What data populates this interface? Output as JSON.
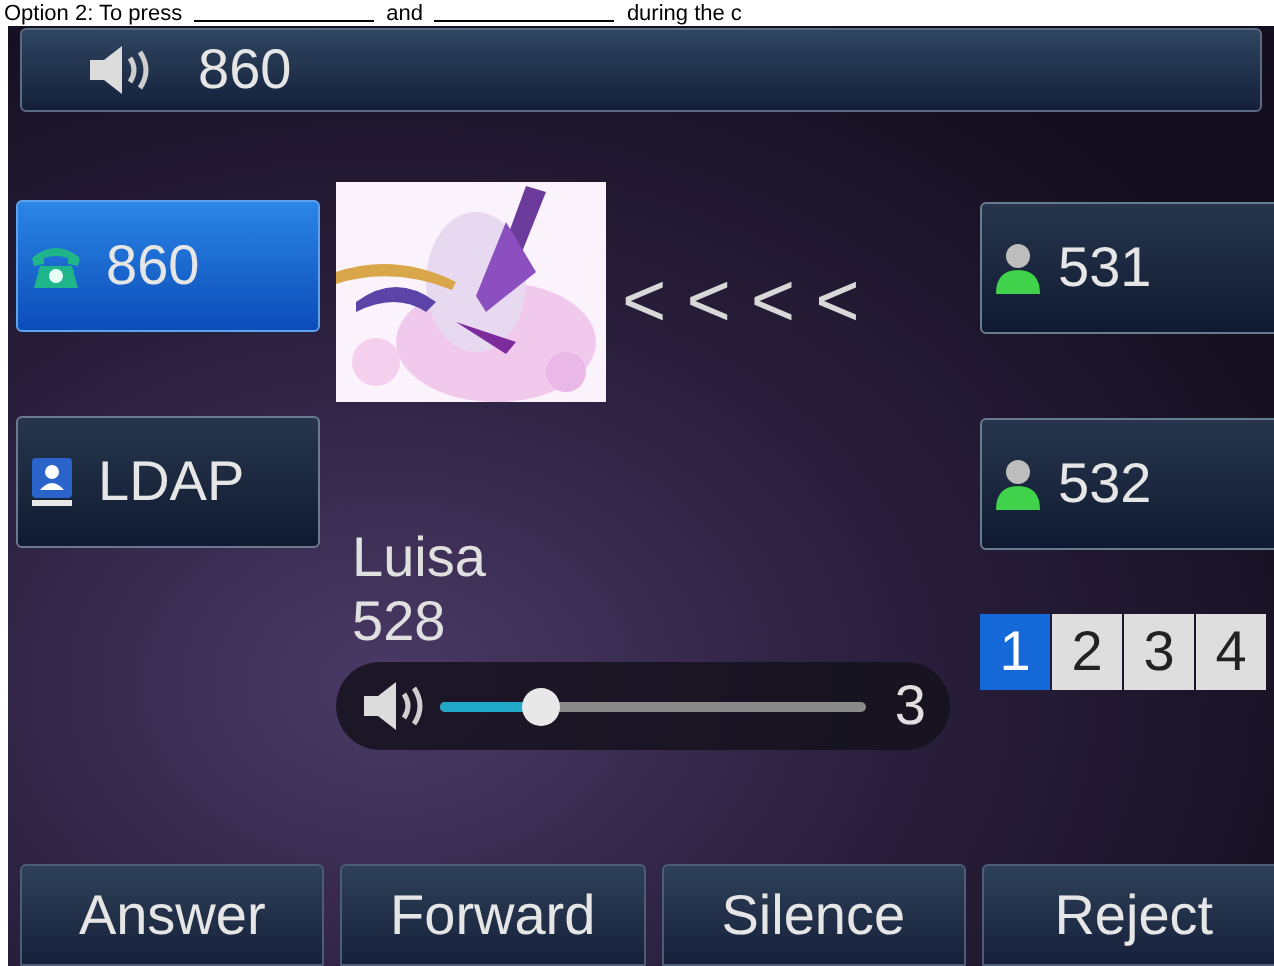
{
  "doc_text": {
    "before": "Option 2: To press",
    "middle": "and",
    "after": "during the c"
  },
  "top_bar": {
    "label": "860"
  },
  "lines": [
    {
      "label": "860",
      "selected": true,
      "kind": "phone"
    },
    {
      "label": "LDAP",
      "selected": false,
      "kind": "directory"
    }
  ],
  "transfer_arrows": [
    "<",
    "<",
    "<",
    "<"
  ],
  "contacts": [
    {
      "label": "531"
    },
    {
      "label": "532"
    }
  ],
  "caller": {
    "name": "Luisa",
    "number": "528"
  },
  "volume": {
    "level": 0.24,
    "reading": "3"
  },
  "pages": [
    {
      "label": "1",
      "selected": true
    },
    {
      "label": "2",
      "selected": false
    },
    {
      "label": "3",
      "selected": false
    },
    {
      "label": "4",
      "selected": false
    }
  ],
  "softkeys": [
    "Answer",
    "Forward",
    "Silence",
    "Reject"
  ]
}
